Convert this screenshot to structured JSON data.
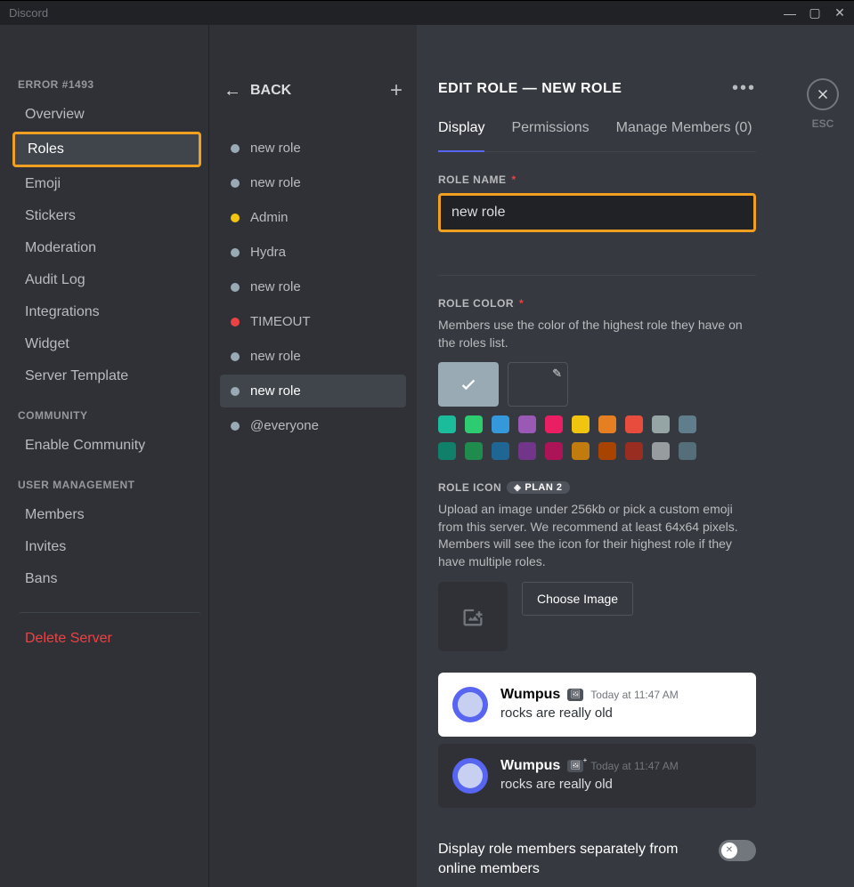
{
  "app_title": "Discord",
  "titlebar": {
    "minimize": "—",
    "maximize": "▢",
    "close": "✕"
  },
  "sidebar": {
    "header1": "ERROR #1493",
    "items1": [
      "Overview",
      "Roles",
      "Emoji",
      "Stickers",
      "Moderation",
      "Audit Log",
      "Integrations",
      "Widget",
      "Server Template"
    ],
    "header2": "COMMUNITY",
    "items2": [
      "Enable Community"
    ],
    "header3": "USER MANAGEMENT",
    "items3": [
      "Members",
      "Invites",
      "Bans"
    ],
    "delete": "Delete Server"
  },
  "middle": {
    "back_label": "BACK",
    "roles": [
      {
        "name": "new role",
        "color": "#99aab5"
      },
      {
        "name": "new role",
        "color": "#99aab5"
      },
      {
        "name": "Admin",
        "color": "#f1c40f"
      },
      {
        "name": "Hydra",
        "color": "#99aab5"
      },
      {
        "name": "new role",
        "color": "#99aab5"
      },
      {
        "name": "TIMEOUT",
        "color": "#ed4245"
      },
      {
        "name": "new role",
        "color": "#99aab5"
      },
      {
        "name": "new role",
        "color": "#99aab5"
      },
      {
        "name": "@everyone",
        "color": "#99aab5"
      }
    ],
    "selected_index": 7
  },
  "content": {
    "title": "EDIT ROLE — NEW ROLE",
    "esc_label": "ESC",
    "tabs": [
      "Display",
      "Permissions",
      "Manage Members (0)"
    ],
    "active_tab": 0,
    "role_name_label": "ROLE NAME",
    "role_name_value": "new role",
    "role_color_label": "ROLE COLOR",
    "role_color_desc": "Members use the color of the highest role they have on the roles list.",
    "swatches_row1": [
      "#1abc9c",
      "#2ecc71",
      "#3498db",
      "#9b59b6",
      "#e91e63",
      "#f1c40f",
      "#e67e22",
      "#e74c3c",
      "#95a5a6",
      "#607d8b"
    ],
    "swatches_row2": [
      "#11806a",
      "#1f8b4c",
      "#206694",
      "#71368a",
      "#ad1457",
      "#c27c0e",
      "#a84300",
      "#992d22",
      "#979c9f",
      "#546e7a"
    ],
    "role_icon_label": "ROLE ICON",
    "plan_badge": "PLAN 2",
    "role_icon_desc": "Upload an image under 256kb or pick a custom emoji from this server. We recommend at least 64x64 pixels. Members will see the icon for their highest role if they have multiple roles.",
    "choose_image": "Choose Image",
    "preview_user": "Wumpus",
    "preview_time": "Today at 11:47 AM",
    "preview_msg": "rocks are really old",
    "toggle_label": "Display role members separately from online members"
  }
}
